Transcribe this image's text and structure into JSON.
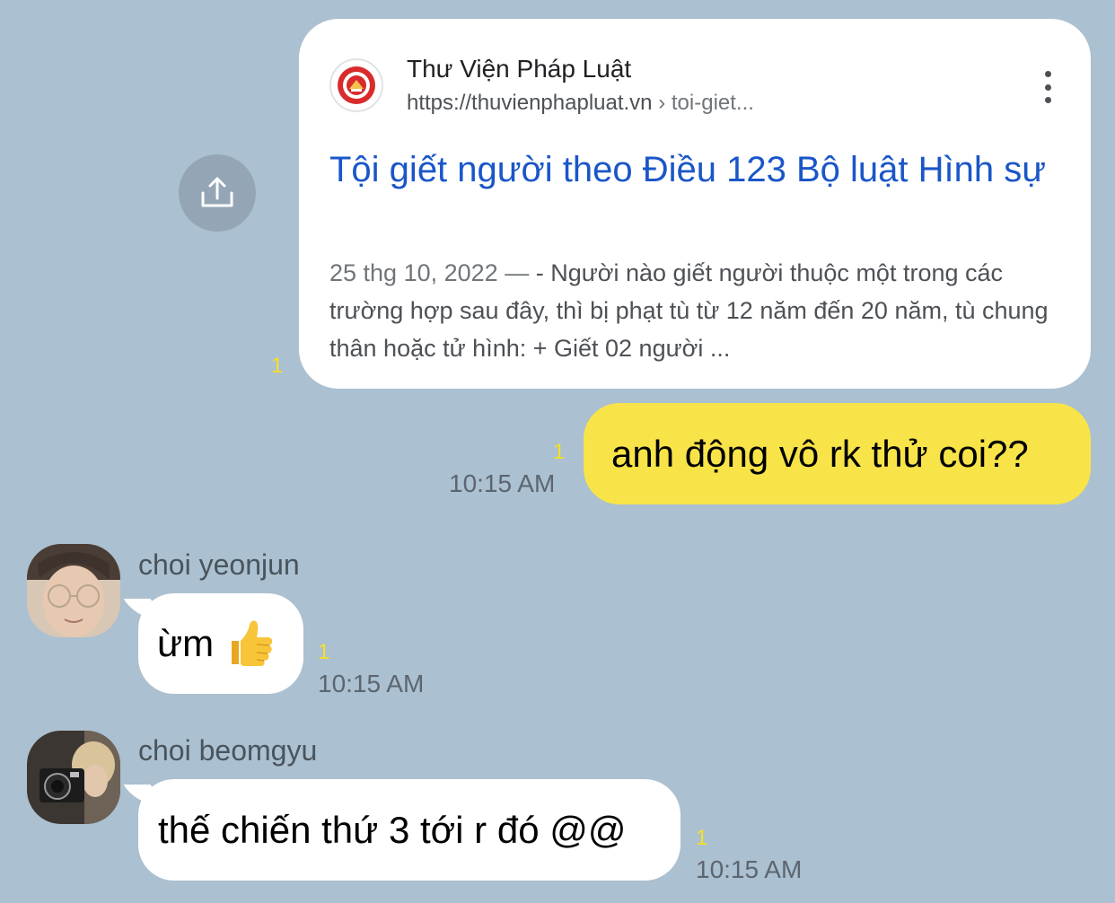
{
  "link_message": {
    "share_icon": "share-upload-icon",
    "site_name": "Thư Viện Pháp Luật",
    "site_url": "https://thuvienphapluat.vn",
    "url_separator": "›",
    "url_path": "toi-giet...",
    "more_icon": "more-vertical-icon",
    "title": "Tội giết người theo Điều 123 Bộ luật Hình sự",
    "date": "25 thg 10, 2022",
    "snippet_dash": "—",
    "snippet": "- Người nào giết người thuộc một trong các trường hợp sau đây, thì bị phạt tù từ 12 năm đến 20 năm, tù chung thân hoặc tử hình: + Giết 02 người ...",
    "read_count": "1"
  },
  "messages": [
    {
      "sender": "me",
      "text": "anh động vô rk thử coi??",
      "read_count": "1",
      "time": "10:15 AM"
    },
    {
      "sender": "choi yeonjun",
      "text": "ừm",
      "emoji": "thumbs-up-icon",
      "read_count": "1",
      "time": "10:15 AM"
    },
    {
      "sender": "choi beomgyu",
      "text": "thế chiến thứ 3 tới r đó @@",
      "read_count": "1",
      "time": "10:15 AM"
    }
  ],
  "colors": {
    "background": "#abc0d0",
    "my_bubble": "#f8e448",
    "their_bubble": "#ffffff",
    "read_count": "#f5e028",
    "link_title": "#1a56c8"
  }
}
